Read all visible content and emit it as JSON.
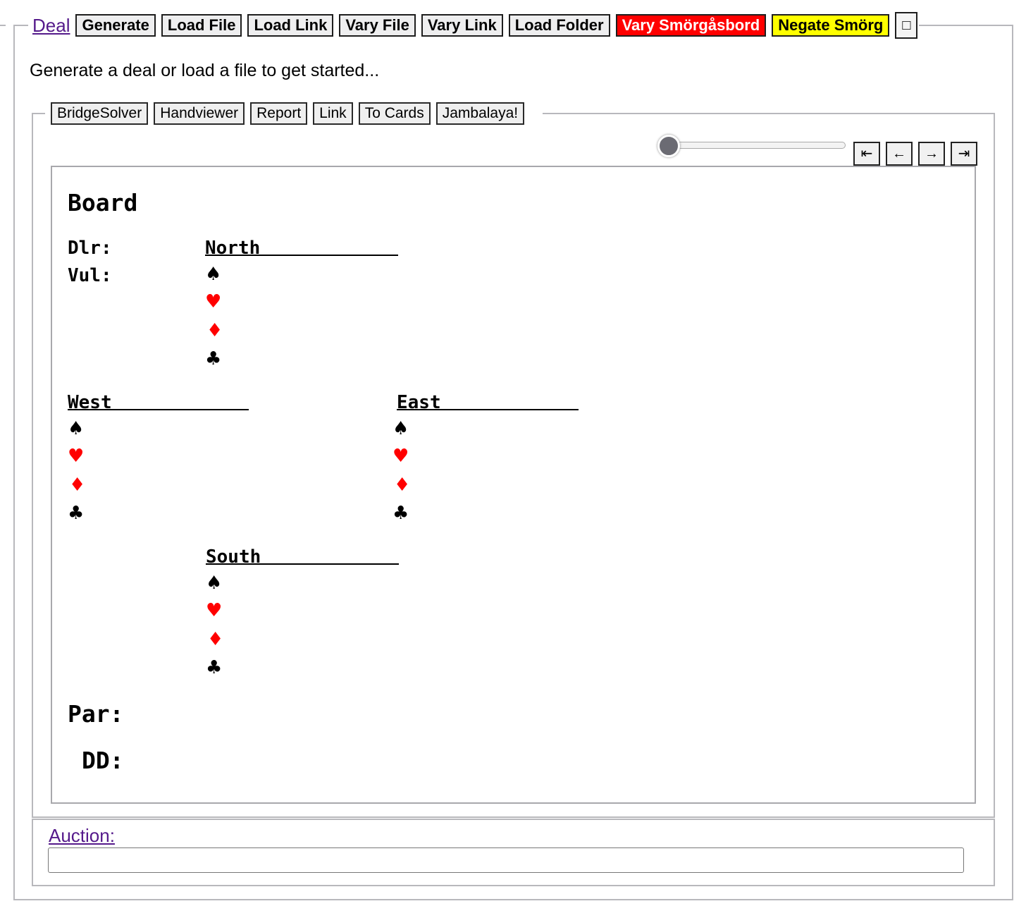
{
  "header": {
    "deal_link": "Deal",
    "buttons": [
      "Generate",
      "Load File",
      "Load Link",
      "Vary File",
      "Vary Link",
      "Load Folder",
      "Vary Smörgåsbord",
      "Negate Smörg"
    ],
    "square_button": "□"
  },
  "intro_text": "Generate a deal or load a file to get started...",
  "tools": [
    "BridgeSolver",
    "Handviewer",
    "Report",
    "Link",
    "To Cards",
    "Jambalaya!"
  ],
  "slider": {
    "value": 0
  },
  "nav": {
    "first": "⇤",
    "prev": "←",
    "next": "→",
    "last": "⇥"
  },
  "board": {
    "title": "Board",
    "dealer_label": "Dlr:",
    "vul_label": "Vul:",
    "north": "North",
    "west": "West",
    "east": "East",
    "south": "South",
    "suits": {
      "spade": "♠",
      "heart": "♥",
      "diamond": "♦",
      "club": "♣"
    },
    "par_label": "Par:",
    "dd_label": "DD:"
  },
  "auction": {
    "label": "Auction:",
    "value": ""
  },
  "colors": {
    "red_button": "#ff0000",
    "yellow_button": "#ffff00",
    "link": "#551a8b",
    "red_suit": "#ff0000"
  }
}
